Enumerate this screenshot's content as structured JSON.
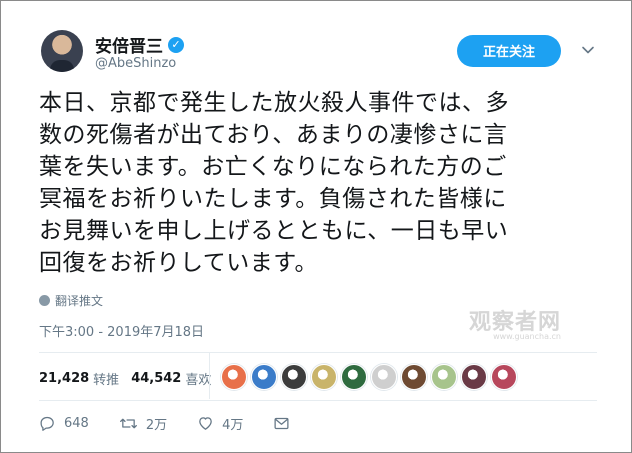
{
  "user": {
    "name": "安倍晋三",
    "handle": "@AbeShinzo",
    "verified_mark": "✓"
  },
  "follow_button": {
    "label": "正在关注"
  },
  "tweet": {
    "text": "本日、京都で発生した放火殺人事件では、多\n数の死傷者が出ており、あまりの凄惨さに言\n葉を失います。お亡くなりになられた方のご\n冥福をお祈りいたします。負傷された皆様に\nお見舞いを申し上げるとともに、一日も早い\n回復をお祈りしています。",
    "translate_label": "翻译推文",
    "timestamp": "下午3:00 - 2019年7月18日"
  },
  "stats": {
    "retweets_count": "21,428",
    "retweets_label": "转推",
    "likes_count": "44,542",
    "likes_label": "喜欢"
  },
  "likers": [
    {
      "color": "#e8704a"
    },
    {
      "color": "#3b7cc9"
    },
    {
      "color": "#3c3c3c"
    },
    {
      "color": "#c9b46a"
    },
    {
      "color": "#2f6b3f"
    },
    {
      "color": "#cfcfcf"
    },
    {
      "color": "#6e4a32"
    },
    {
      "color": "#a7c48c"
    },
    {
      "color": "#6a3a46"
    },
    {
      "color": "#b7475c"
    }
  ],
  "actions": {
    "reply_count": "648",
    "retweet_count": "2万",
    "like_count": "4万"
  },
  "watermark": {
    "main": "观察者网",
    "sub": "www.guancha.cn"
  },
  "colors": {
    "accent": "#1da1f2",
    "secondary_text": "#657786"
  }
}
